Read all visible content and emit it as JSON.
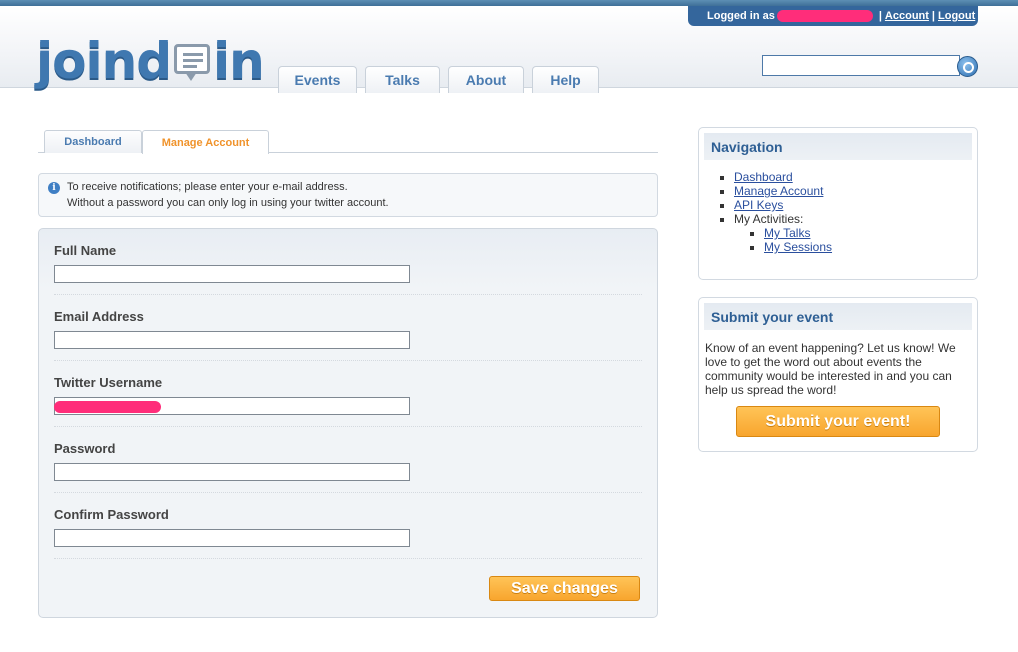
{
  "header": {
    "logo_left": "joind",
    "logo_right": "in",
    "login": {
      "prefix": "Logged in as",
      "account_link": "Account",
      "separator": "|",
      "logout_link": "Logout"
    },
    "nav_tabs": [
      {
        "label": "Events"
      },
      {
        "label": "Talks"
      },
      {
        "label": "About"
      },
      {
        "label": "Help"
      }
    ],
    "search": {
      "value": "",
      "button_icon": "search-icon"
    }
  },
  "subtabs": [
    {
      "label": "Dashboard",
      "active": false
    },
    {
      "label": "Manage Account",
      "active": true
    }
  ],
  "info": {
    "line1": "To receive notifications; please enter your e-mail address.",
    "line2": "Without a password you can only log in using your twitter account."
  },
  "form": {
    "fields": [
      {
        "label": "Full Name",
        "value": ""
      },
      {
        "label": "Email Address",
        "value": ""
      },
      {
        "label": "Twitter Username",
        "value": ""
      },
      {
        "label": "Password",
        "value": ""
      },
      {
        "label": "Confirm Password",
        "value": ""
      }
    ],
    "save_label": "Save changes"
  },
  "sidebar": {
    "navigation": {
      "title": "Navigation",
      "items": [
        "Dashboard",
        "Manage Account",
        "API Keys"
      ],
      "activities_label": "My Activities:",
      "activities": [
        "My Talks",
        "My Sessions"
      ]
    },
    "submit": {
      "title": "Submit your event",
      "text": "Know of an event happening? Let us know! We love to get the word out about events the community would be interested in and you can help us spread the word!",
      "button_label": "Submit your event!"
    }
  },
  "colors": {
    "brand_blue": "#3f78b0",
    "accent_orange": "#f8a52e",
    "link_blue": "#2a4f9e"
  }
}
